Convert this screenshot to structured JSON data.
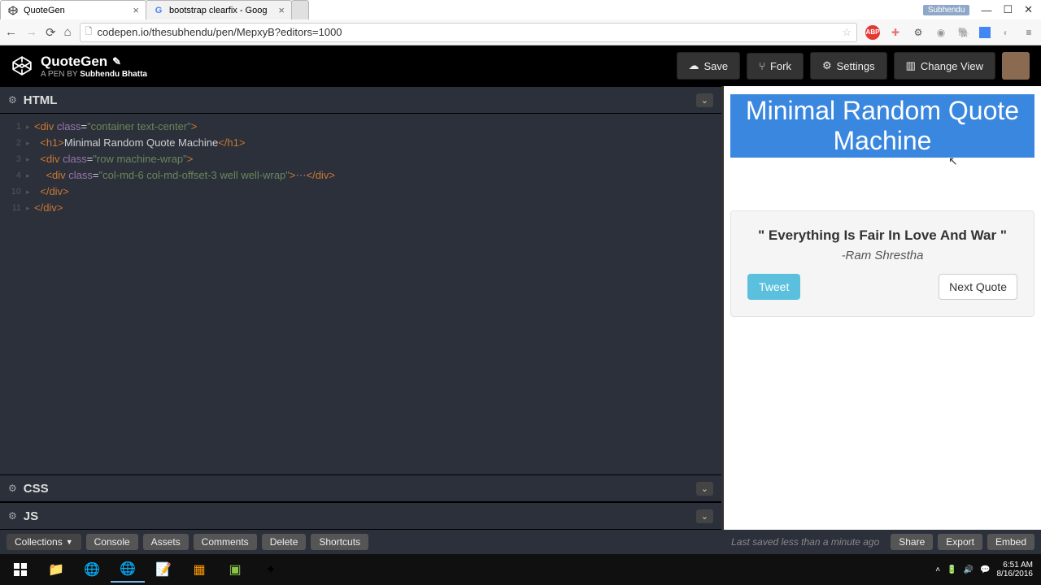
{
  "browser": {
    "tabs": [
      {
        "title": "QuoteGen",
        "active": true
      },
      {
        "title": "bootstrap clearfix - Goog",
        "active": false
      }
    ],
    "user_chip": "Subhendu",
    "url": "codepen.io/thesubhendu/pen/MepxyB?editors=1000"
  },
  "codepen": {
    "title": "QuoteGen",
    "pen_by_prefix": "A PEN BY ",
    "author": "Subhendu Bhatta",
    "buttons": {
      "save": "Save",
      "fork": "Fork",
      "settings": "Settings",
      "change_view": "Change View"
    }
  },
  "panels": {
    "html": "HTML",
    "css": "CSS",
    "js": "JS"
  },
  "code": {
    "lines": [
      {
        "n": "1",
        "html": "<span class='c-tag'>&lt;div</span> <span class='c-attr'>class</span>=<span class='c-str'>\"container text-center\"</span><span class='c-tag'>&gt;</span>"
      },
      {
        "n": "2",
        "html": "  <span class='c-tag'>&lt;h1&gt;</span><span class='c-txt'>Minimal Random Quote Machine</span><span class='c-tag'>&lt;/h1&gt;</span>"
      },
      {
        "n": "3",
        "html": "  <span class='c-tag'>&lt;div</span> <span class='c-attr'>class</span>=<span class='c-str'>\"row machine-wrap\"</span><span class='c-tag'>&gt;</span>"
      },
      {
        "n": "4",
        "html": "    <span class='c-tag'>&lt;div</span> <span class='c-attr'>class</span>=<span class='c-str'>\"col-md-6 col-md-offset-3 well well-wrap\"</span><span class='c-tag'>&gt;</span><span class='c-attr'>⋯</span><span class='c-tag'>&lt;/div&gt;</span>"
      },
      {
        "n": "10",
        "html": "  <span class='c-tag'>&lt;/div&gt;</span>"
      },
      {
        "n": "11",
        "html": "<span class='c-tag'>&lt;/div&gt;</span>"
      }
    ]
  },
  "preview": {
    "heading": "Minimal Random Quote Machine",
    "quote": "\" Everything Is Fair In Love And War \"",
    "author": "-Ram Shrestha",
    "tweet": "Tweet",
    "next": "Next Quote"
  },
  "footer": {
    "collections": "Collections",
    "console": "Console",
    "assets": "Assets",
    "comments": "Comments",
    "delete": "Delete",
    "shortcuts": "Shortcuts",
    "saved": "Last saved less than a minute ago",
    "share": "Share",
    "export": "Export",
    "embed": "Embed"
  },
  "taskbar": {
    "time": "6:51 AM",
    "date": "8/16/2016"
  }
}
